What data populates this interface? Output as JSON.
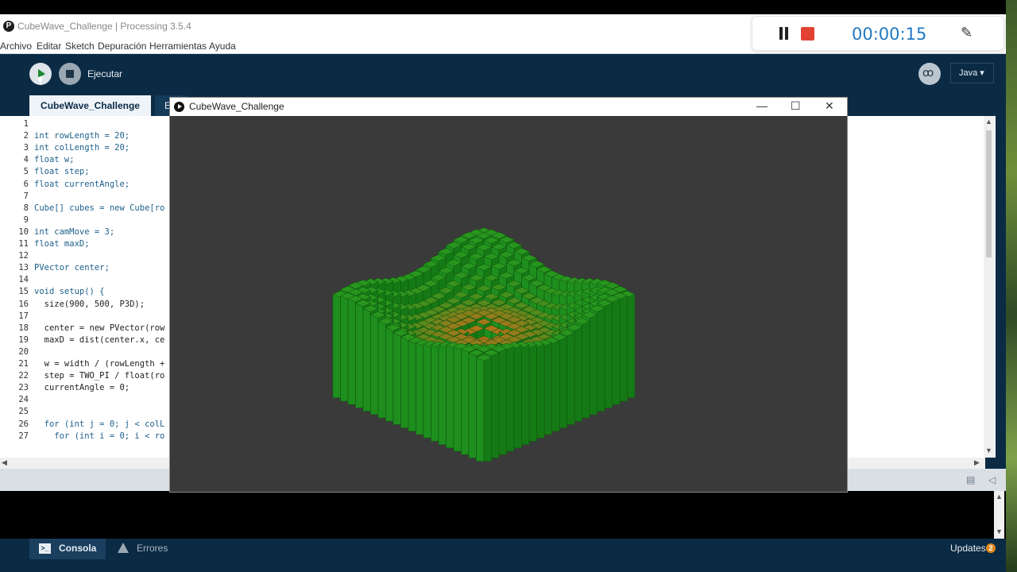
{
  "ide": {
    "title": "CubeWave_Challenge | Processing 3.5.4",
    "menu": [
      "Archivo",
      "Editar",
      "Sketch",
      "Depuración",
      "Herramientas",
      "Ayuda"
    ],
    "toolbar": {
      "run_label": "Ejecutar",
      "mode": "Java ▾"
    },
    "tabs": {
      "active": "CubeWave_Challenge",
      "second_partial": "E"
    },
    "code_lines": [
      "",
      "int rowLength = 20;",
      "int colLength = 20;",
      "float w;",
      "float step;",
      "float currentAngle;",
      "",
      "Cube[] cubes = new Cube[ro",
      "",
      "int camMove = 3;",
      "float maxD;",
      "",
      "PVector center;",
      "",
      "void setup() {",
      "  size(900, 500, P3D);",
      "",
      "  center = new PVector(row",
      "  maxD = dist(center.x, ce",
      "",
      "  w = width / (rowLength +",
      "  step = TWO_PI / float(ro",
      "  currentAngle = 0;",
      "",
      "",
      "  for (int j = 0; j < colL",
      "    for (int i = 0; i < ro"
    ],
    "bottom": {
      "console": "Consola",
      "errors": "Errores",
      "updates": "Updates",
      "updates_count": "2"
    }
  },
  "recorder": {
    "timer": "00:00:15"
  },
  "sketch": {
    "title": "CubeWave_Challenge"
  },
  "colors": {
    "ide_bg": "#0b2a44",
    "cube_green": "#1fa21f",
    "cube_orange": "#c06a1a",
    "canvas_bg": "#3a3a3a",
    "timer_blue": "#2179c4",
    "record_red": "#e24234"
  }
}
